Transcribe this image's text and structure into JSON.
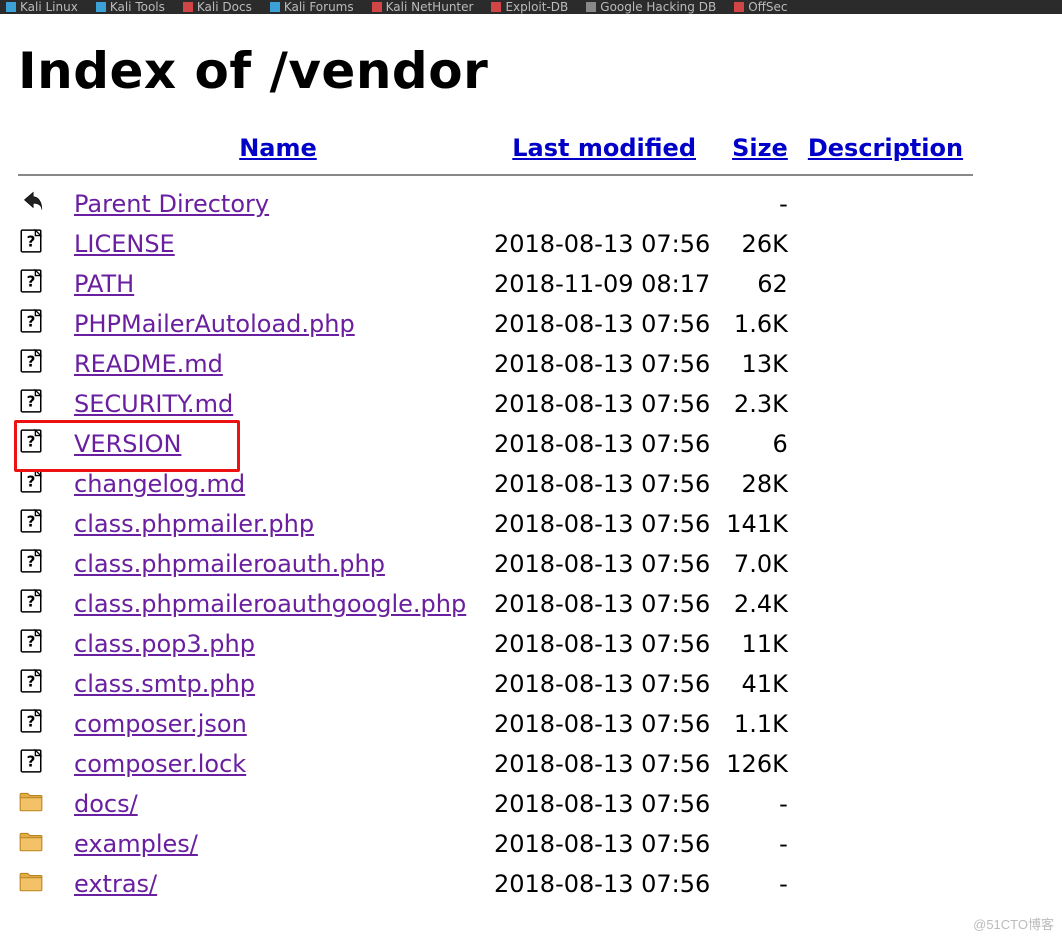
{
  "bookmarks": [
    {
      "label": "Kali Linux",
      "iconColor": "#3aa0d6"
    },
    {
      "label": "Kali Tools",
      "iconColor": "#3aa0d6"
    },
    {
      "label": "Kali Docs",
      "iconColor": "#d04545"
    },
    {
      "label": "Kali Forums",
      "iconColor": "#3aa0d6"
    },
    {
      "label": "Kali NetHunter",
      "iconColor": "#d04545"
    },
    {
      "label": "Exploit-DB",
      "iconColor": "#d04545"
    },
    {
      "label": "Google Hacking DB",
      "iconColor": "#888888"
    },
    {
      "label": "OffSec",
      "iconColor": "#d04545"
    }
  ],
  "page_title": "Index of /vendor",
  "columns": {
    "name": "Name",
    "last_modified": "Last modified",
    "size": "Size",
    "description": "Description"
  },
  "parent_dir_label": "Parent Directory",
  "entries": [
    {
      "type": "parent",
      "name": "Parent Directory",
      "modified": "",
      "size": "-",
      "highlighted": false
    },
    {
      "type": "file",
      "name": "LICENSE",
      "modified": "2018-08-13 07:56",
      "size": "26K",
      "highlighted": false
    },
    {
      "type": "file",
      "name": "PATH",
      "modified": "2018-11-09 08:17",
      "size": "62",
      "highlighted": false
    },
    {
      "type": "file",
      "name": "PHPMailerAutoload.php",
      "modified": "2018-08-13 07:56",
      "size": "1.6K",
      "highlighted": false
    },
    {
      "type": "file",
      "name": "README.md",
      "modified": "2018-08-13 07:56",
      "size": "13K",
      "highlighted": false
    },
    {
      "type": "file",
      "name": "SECURITY.md",
      "modified": "2018-08-13 07:56",
      "size": "2.3K",
      "highlighted": false
    },
    {
      "type": "file",
      "name": "VERSION",
      "modified": "2018-08-13 07:56",
      "size": "6",
      "highlighted": true
    },
    {
      "type": "file",
      "name": "changelog.md",
      "modified": "2018-08-13 07:56",
      "size": "28K",
      "highlighted": false
    },
    {
      "type": "file",
      "name": "class.phpmailer.php",
      "modified": "2018-08-13 07:56",
      "size": "141K",
      "highlighted": false
    },
    {
      "type": "file",
      "name": "class.phpmaileroauth.php",
      "modified": "2018-08-13 07:56",
      "size": "7.0K",
      "highlighted": false
    },
    {
      "type": "file",
      "name": "class.phpmaileroauthgoogle.php",
      "modified": "2018-08-13 07:56",
      "size": "2.4K",
      "highlighted": false
    },
    {
      "type": "file",
      "name": "class.pop3.php",
      "modified": "2018-08-13 07:56",
      "size": "11K",
      "highlighted": false
    },
    {
      "type": "file",
      "name": "class.smtp.php",
      "modified": "2018-08-13 07:56",
      "size": "41K",
      "highlighted": false
    },
    {
      "type": "file",
      "name": "composer.json",
      "modified": "2018-08-13 07:56",
      "size": "1.1K",
      "highlighted": false
    },
    {
      "type": "file",
      "name": "composer.lock",
      "modified": "2018-08-13 07:56",
      "size": "126K",
      "highlighted": false
    },
    {
      "type": "dir",
      "name": "docs/",
      "modified": "2018-08-13 07:56",
      "size": "-",
      "highlighted": false
    },
    {
      "type": "dir",
      "name": "examples/",
      "modified": "2018-08-13 07:56",
      "size": "-",
      "highlighted": false
    },
    {
      "type": "dir",
      "name": "extras/",
      "modified": "2018-08-13 07:56",
      "size": "-",
      "highlighted": false
    }
  ],
  "watermark": "@51CTO博客"
}
